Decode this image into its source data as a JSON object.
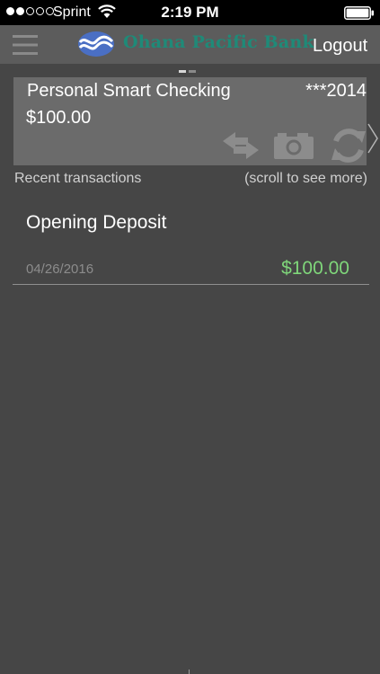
{
  "status_bar": {
    "signal_bars_filled": 2,
    "signal_bars_total": 5,
    "carrier": "Sprint",
    "time": "2:19 PM",
    "wifi_icon": "wifi-icon",
    "battery_icon": "battery-full-icon"
  },
  "header": {
    "menu_icon": "hamburger-menu-icon",
    "bank_name": "Ohana Pacific Bank",
    "logout_label": "Logout"
  },
  "pager": {
    "page_count": 2,
    "active_index": 0
  },
  "account": {
    "name": "Personal Smart Checking",
    "number_masked": "***2014",
    "balance": "$100.00",
    "actions": [
      "transfer-icon",
      "camera-icon",
      "refresh-icon"
    ]
  },
  "recent": {
    "label": "Recent transactions",
    "scroll_hint": "(scroll to see more)"
  },
  "transactions": [
    {
      "description": "Opening Deposit",
      "date": "04/26/2016",
      "amount": "$100.00"
    }
  ],
  "colors": {
    "background": "#464646",
    "header": "#5c5c5c",
    "card": "#6b6b6b",
    "brand_green": "#1f8a78",
    "brand_blue": "#4a6fc4",
    "positive_amount": "#7fd67a"
  }
}
